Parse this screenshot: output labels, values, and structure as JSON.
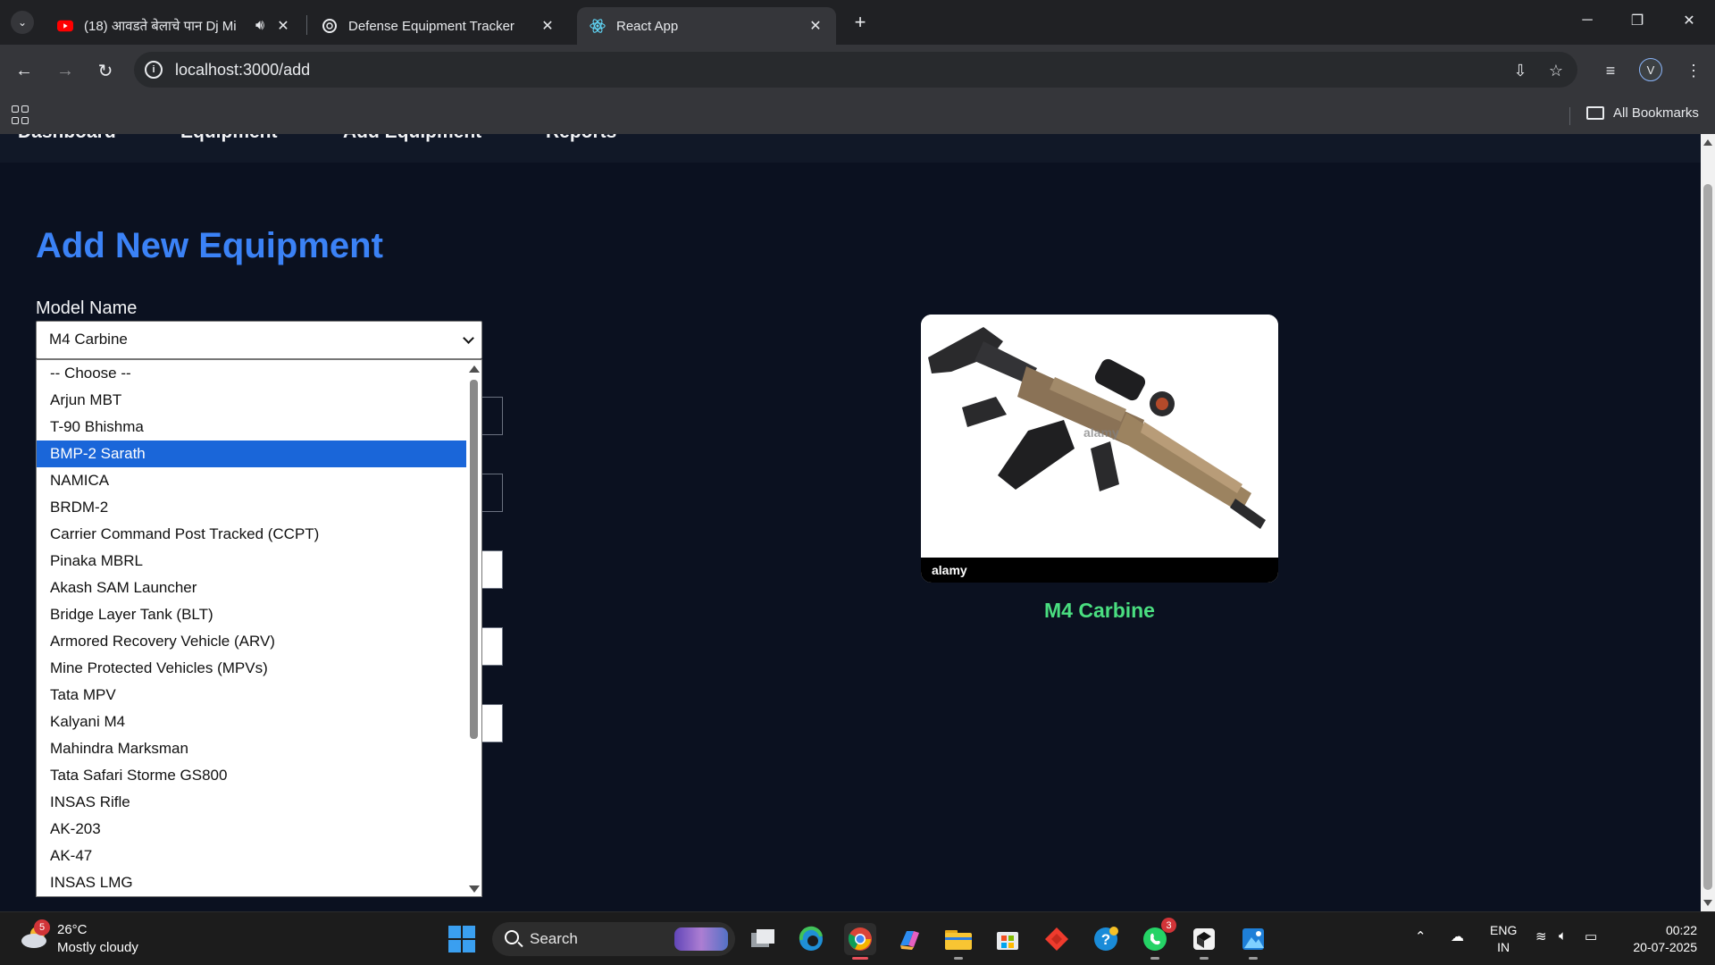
{
  "browser": {
    "tabs": [
      {
        "title": "(18) आवडते बेलाचे पान Dj Mi",
        "favicon": "youtube-icon",
        "audio": true,
        "active": false
      },
      {
        "title": "Defense Equipment Tracker",
        "favicon": "openai-icon",
        "active": false
      },
      {
        "title": "React App",
        "favicon": "react-icon",
        "active": true
      }
    ],
    "url": "localhost:3000/add",
    "profile_initial": "V",
    "bookmarks_label": "All Bookmarks"
  },
  "app": {
    "nav": [
      "Dashboard",
      "Equipment",
      "Add Equipment",
      "Reports"
    ],
    "heading": "Add New Equipment",
    "model_label": "Model Name",
    "selected_model": "M4 Carbine",
    "highlighted_option": "BMP-2 Sarath",
    "options": [
      "-- Choose --",
      "Arjun MBT",
      "T-90 Bhishma",
      "BMP-2 Sarath",
      "NAMICA",
      "BRDM-2",
      "Carrier Command Post Tracked (CCPT)",
      "Pinaka MBRL",
      "Akash SAM Launcher",
      "Bridge Layer Tank (BLT)",
      "Armored Recovery Vehicle (ARV)",
      "Mine Protected Vehicles (MPVs)",
      "Tata MPV",
      "Kalyani M4",
      "Mahindra Marksman",
      "Tata Safari Storme GS800",
      "INSAS Rifle",
      "AK-203",
      "AK-47",
      "INSAS LMG"
    ],
    "preview": {
      "name": "M4 Carbine",
      "image_watermark": "alamy",
      "image_footer_logo": "alamy"
    }
  },
  "taskbar": {
    "weather": {
      "badge": "5",
      "temp": "26°C",
      "desc": "Mostly cloudy"
    },
    "search_label": "Search",
    "whatsapp_badge": "3",
    "language": {
      "line1": "ENG",
      "line2": "IN"
    },
    "time": "00:22",
    "date": "20-07-2025"
  },
  "colors": {
    "page_bg": "#0b1120",
    "heading": "#3b82f6",
    "preview_name": "#4ade80",
    "option_highlight": "#1a66d9"
  }
}
